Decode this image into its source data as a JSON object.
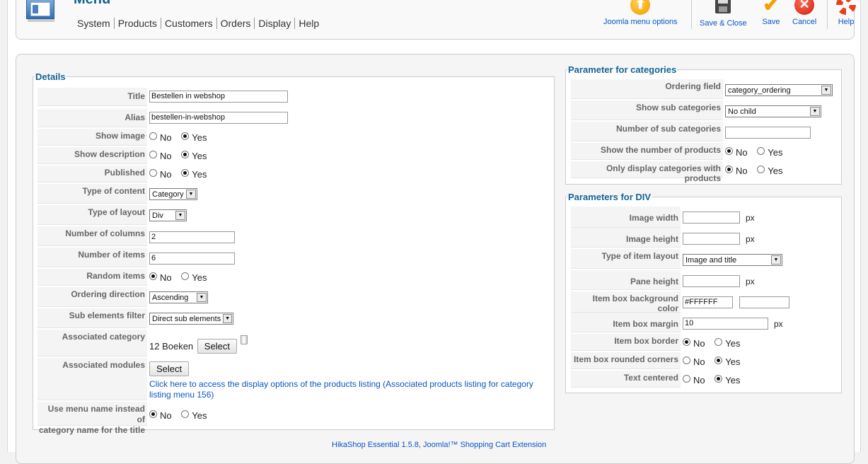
{
  "header": {
    "title": "Menu",
    "menu": [
      "System",
      "Products",
      "Customers",
      "Orders",
      "Display",
      "Help"
    ]
  },
  "toolbar": {
    "joomla_options": "Joomla menu options",
    "save_close": "Save & Close",
    "save": "Save",
    "cancel": "Cancel",
    "help": "Help"
  },
  "details": {
    "legend": "Details",
    "title_label": "Title",
    "title_value": "Bestellen in webshop",
    "alias_label": "Alias",
    "alias_value": "bestellen-in-webshop",
    "show_image_label": "Show image",
    "show_description_label": "Show description",
    "published_label": "Published",
    "no": "No",
    "yes": "Yes",
    "type_content_label": "Type of content",
    "type_content_value": "Category",
    "type_layout_label": "Type of layout",
    "type_layout_value": "Div",
    "num_columns_label": "Number of columns",
    "num_columns_value": "2",
    "num_items_label": "Number of items",
    "num_items_value": "6",
    "random_items_label": "Random items",
    "ordering_direction_label": "Ordering direction",
    "ordering_direction_value": "Ascending",
    "sub_filter_label": "Sub elements filter",
    "sub_filter_value": "Direct sub elements",
    "assoc_category_label": "Associated category",
    "assoc_category_value": "12 Boeken",
    "select": "Select",
    "assoc_modules_label": "Associated modules",
    "link_text": "Click here to access the display options of the products listing (Associated products listing for category listing menu 156)",
    "menu_name_label_1": "Use menu name instead of",
    "menu_name_label_2": "category name for the title"
  },
  "categories": {
    "legend": "Parameter for categories",
    "ordering_label": "Ordering field",
    "ordering_value": "category_ordering",
    "show_sub_label": "Show sub categories",
    "show_sub_value": "No child",
    "num_sub_label": "Number of sub categories",
    "num_sub_value": "",
    "show_num_products_label": "Show the number of products",
    "only_display_label": "Only display categories with products"
  },
  "div": {
    "legend": "Parameters for DIV",
    "image_width_label": "Image width",
    "image_height_label": "Image height",
    "item_layout_label": "Type of item layout",
    "item_layout_value": "Image and title",
    "pane_height_label": "Pane height",
    "bg_color_label": "Item box background color",
    "bg_color_value": "#FFFFFF",
    "margin_label": "Item box margin",
    "margin_value": "10",
    "border_label": "Item box border",
    "rounded_label": "Item box rounded corners",
    "centered_label": "Text centered",
    "px": "px"
  },
  "footer": "HikaShop Essential 1.5.8, Joomla!™ Shopping Cart Extension"
}
